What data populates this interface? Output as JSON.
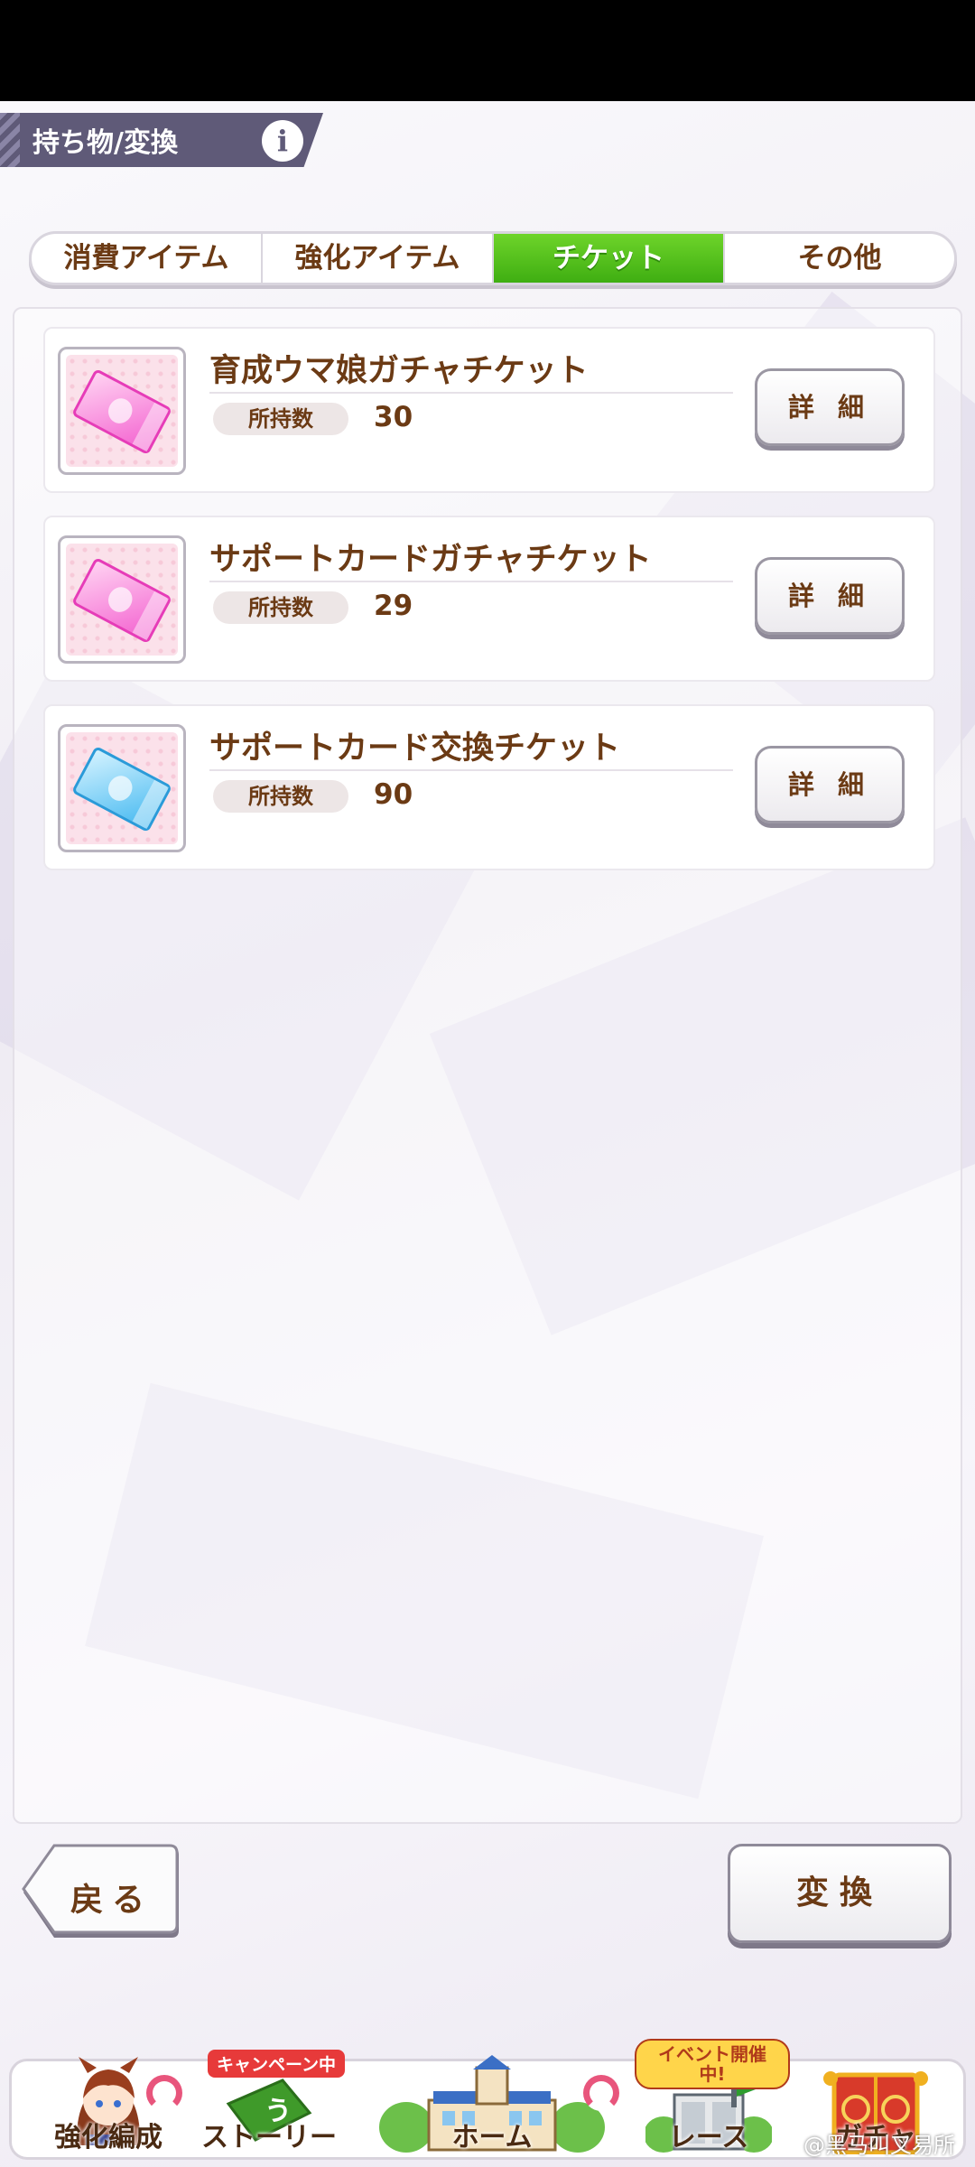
{
  "header": {
    "title": "持ち物/変換",
    "info_icon": "i"
  },
  "tabs": [
    {
      "label": "消費アイテム",
      "active": false
    },
    {
      "label": "強化アイテム",
      "active": false
    },
    {
      "label": "チケット",
      "active": true
    },
    {
      "label": "その他",
      "active": false
    }
  ],
  "items": [
    {
      "name": "育成ウマ娘ガチャチケット",
      "owned_label": "所持数",
      "count": "30",
      "detail_label": "詳 細",
      "icon": "pink-ticket-icon"
    },
    {
      "name": "サポートカードガチャチケット",
      "owned_label": "所持数",
      "count": "29",
      "detail_label": "詳 細",
      "icon": "pink-ticket-icon"
    },
    {
      "name": "サポートカード交換チケット",
      "owned_label": "所持数",
      "count": "90",
      "detail_label": "詳 細",
      "icon": "blue-ticket-icon"
    }
  ],
  "footer": {
    "back_label": "戻る",
    "exchange_label": "変換"
  },
  "nav": [
    {
      "label": "強化編成"
    },
    {
      "label": "ストーリー",
      "badge": "キャンペーン中"
    },
    {
      "label": "ホーム"
    },
    {
      "label": "レース",
      "badge": "イベント開催中!"
    },
    {
      "label": "ガチャ"
    }
  ],
  "watermark": "@黑马叫叉易所"
}
